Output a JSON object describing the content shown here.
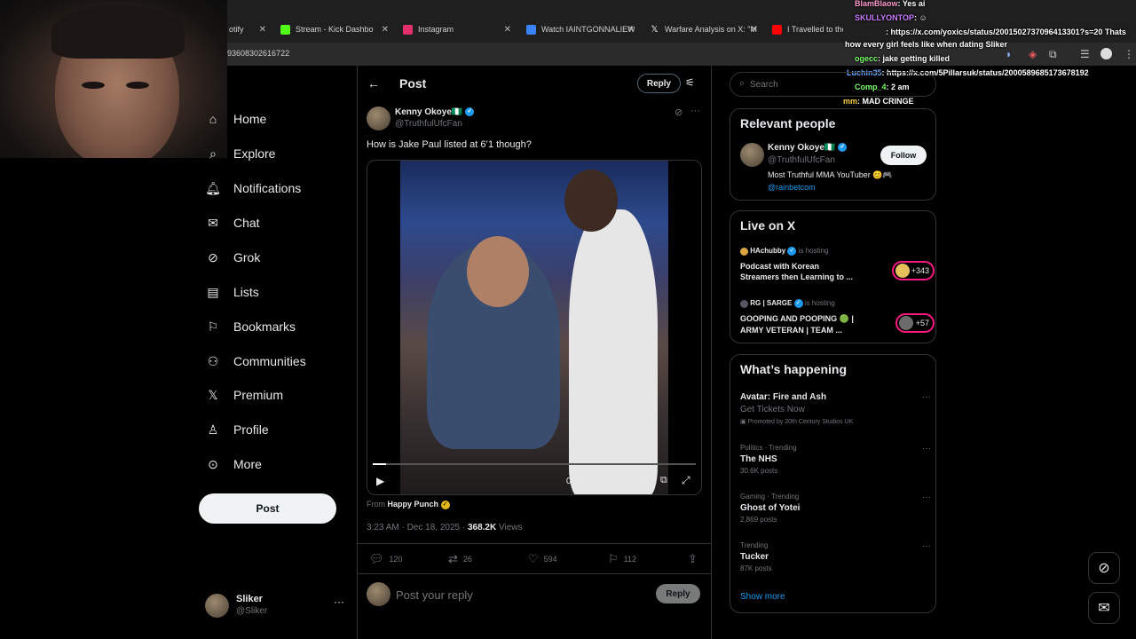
{
  "browser": {
    "tabs": [
      {
        "label": "otify",
        "color": "#1db954"
      },
      {
        "label": "Stream - Kick Dashbo",
        "color": "#53fc18"
      },
      {
        "label": "Instagram",
        "color": "#e1306c"
      },
      {
        "label": "Watch IAINTGONNALIEW",
        "color": "#3b82f6"
      },
      {
        "label": "Warfare Analysis on X: \"M",
        "color": "#ffffff"
      },
      {
        "label": "I Travelled to the Most R",
        "color": "#ff0000"
      }
    ],
    "url": "93608302616722"
  },
  "chat": [
    {
      "user": "BlamBlaow",
      "msg": ": Yes ai",
      "color": "#ff9acb"
    },
    {
      "user": "SKULLYONTOP",
      "msg": ": ☺",
      "color": "#c87cff"
    },
    {
      "user": "",
      "msg": ": https://x.com/yoxics/status/2001502737096413301?s=20 Thats",
      "color": "#ff7ad1"
    },
    {
      "user": "",
      "msg": "how every girl feels like when dating Sliker",
      "color": "#ffffff"
    },
    {
      "user": "ogecc",
      "msg": ": jake getting killed",
      "color": "#7cff6b"
    },
    {
      "user": "Luchin35",
      "msg": ": https://x.com/5Pillarsuk/status/2000589685173678192",
      "color": "#6ba7ff"
    },
    {
      "user": "Comp_4",
      "msg": ": 2 am",
      "color": "#7cff6b"
    },
    {
      "user": "mm",
      "msg": ": MAD CRINGE",
      "color": "#ffd24a"
    }
  ],
  "nav": {
    "items": [
      {
        "label": "Home",
        "icon": "home-icon"
      },
      {
        "label": "Explore",
        "icon": "search-icon"
      },
      {
        "label": "Notifications",
        "icon": "bell-icon"
      },
      {
        "label": "Chat",
        "icon": "envelope-icon"
      },
      {
        "label": "Grok",
        "icon": "grok-icon"
      },
      {
        "label": "Lists",
        "icon": "list-icon"
      },
      {
        "label": "Bookmarks",
        "icon": "bookmark-icon"
      },
      {
        "label": "Communities",
        "icon": "people-icon"
      },
      {
        "label": "Premium",
        "icon": "x-logo-icon"
      },
      {
        "label": "Profile",
        "icon": "person-icon"
      },
      {
        "label": "More",
        "icon": "more-circle-icon"
      }
    ],
    "post_label": "Post",
    "account": {
      "name": "Sliker",
      "handle": "@Sliker"
    }
  },
  "post": {
    "header_title": "Post",
    "reply_label": "Reply",
    "author_name": "Kenny Okoye",
    "author_flag": "🇳🇬",
    "author_handle": "@TruthfulUfcFan",
    "text": "How is Jake Paul listed at 6’1 though?",
    "video_time": "0:01 / 0:24",
    "video_progress": 0.04,
    "from_label": "From",
    "from_source": "Happy Punch",
    "timestamp": "3:23 AM · Dec 18, 2025 ·",
    "views_count": "368.2K",
    "views_label": "Views",
    "stats": {
      "replies": "120",
      "reposts": "26",
      "likes": "594",
      "bookmarks": "112"
    },
    "reply_placeholder": "Post your reply",
    "reply_button": "Reply"
  },
  "search": {
    "placeholder": "Search"
  },
  "relevant": {
    "title": "Relevant people",
    "name": "Kenny Okoye",
    "flag": "🇳🇬",
    "handle": "@TruthfulUfcFan",
    "follow_label": "Follow",
    "bio": "Most Truthful MMA YouTuber 😊🎮",
    "bio_link": "@rainbetcom"
  },
  "live": {
    "title": "Live on X",
    "items": [
      {
        "host": "HAchubby",
        "status": "is hosting",
        "title_line1": "Podcast with Korean",
        "title_line2": "Streamers then Learning to ...",
        "count": "+343"
      },
      {
        "host": "RG | SARGE",
        "status": "is hosting",
        "title_line1": "GOOPING AND POOPING 🟢 |",
        "title_line2": "ARMY VETERAN | TEAM ...",
        "count": "+57"
      }
    ]
  },
  "happening": {
    "title": "What’s happening",
    "promo": {
      "name": "Avatar: Fire and Ash",
      "sub": "Get Tickets Now",
      "promoted": "Promoted by 20th Century Studios UK"
    },
    "trends": [
      {
        "category": "Politics · Trending",
        "name": "The NHS",
        "count": "30.6K posts"
      },
      {
        "category": "Gaming · Trending",
        "name": "Ghost of Yotei",
        "count": "2,869 posts"
      },
      {
        "category": "Trending",
        "name": "Tucker",
        "count": "87K posts"
      }
    ],
    "show_more": "Show more"
  }
}
